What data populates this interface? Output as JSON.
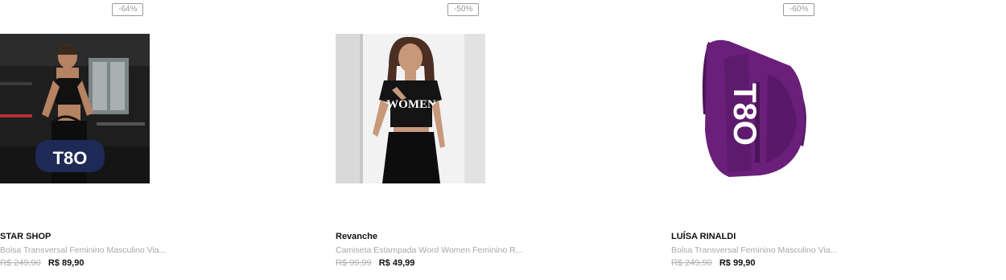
{
  "products": [
    {
      "discount": "-64%",
      "brand": "STAR SHOP",
      "name": "Bolsa Transversal Feminino Masculino Via...",
      "old_price": "R$ 249,90",
      "price": "R$ 89,90",
      "image_logo": "T8O"
    },
    {
      "discount": "-50%",
      "brand": "Revanche",
      "name": "Camiseta Estampada Word Women Feminino R...",
      "old_price": "R$ 99,99",
      "price": "R$ 49,99",
      "image_logo": "WOMEN"
    },
    {
      "discount": "-60%",
      "brand": "LUÍSA RINALDI",
      "name": "Bolsa Transversal Feminino Masculino Via...",
      "old_price": "R$ 249,90",
      "price": "R$ 99,90",
      "image_logo": "T8O"
    }
  ],
  "colors": {
    "badge_border": "#9a9a9a",
    "price_old": "#b0b0b0",
    "bag_navy": "#1d2a55",
    "bag_purple": "#6a1f7a"
  }
}
